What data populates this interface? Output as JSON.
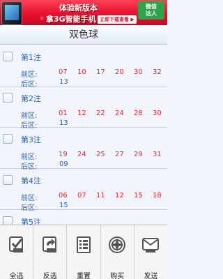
{
  "ad": {
    "line1": "体验新版本",
    "line2": "拿3G智能手机",
    "button": "立即下载查看 ▶",
    "tag": "微信\n达人"
  },
  "title": "双色球",
  "front_label": "前区:",
  "back_label": "后区:",
  "items": [
    {
      "title": "第1注",
      "front": [
        "07",
        "10",
        "17",
        "20",
        "30",
        "32"
      ],
      "back": "13"
    },
    {
      "title": "第2注",
      "front": [
        "01",
        "12",
        "22",
        "24",
        "28",
        "30"
      ],
      "back": "13"
    },
    {
      "title": "第3注",
      "front": [
        "19",
        "24",
        "25",
        "27",
        "29",
        "31"
      ],
      "back": "09"
    },
    {
      "title": "第4注",
      "front": [
        "06",
        "07",
        "11",
        "12",
        "15",
        "18"
      ],
      "back": "15"
    },
    {
      "title": "第5注",
      "front": [],
      "back": ""
    }
  ],
  "toolbar": [
    {
      "label": "全选",
      "icon": "check-all-icon"
    },
    {
      "label": "反选",
      "icon": "invert-icon"
    },
    {
      "label": "重置",
      "icon": "reset-list-icon"
    },
    {
      "label": "购买",
      "icon": "compass-icon"
    },
    {
      "label": "发送",
      "icon": "send-icon"
    }
  ],
  "colors": {
    "front_number": "#e52629",
    "label_blue": "#2b5fae"
  }
}
